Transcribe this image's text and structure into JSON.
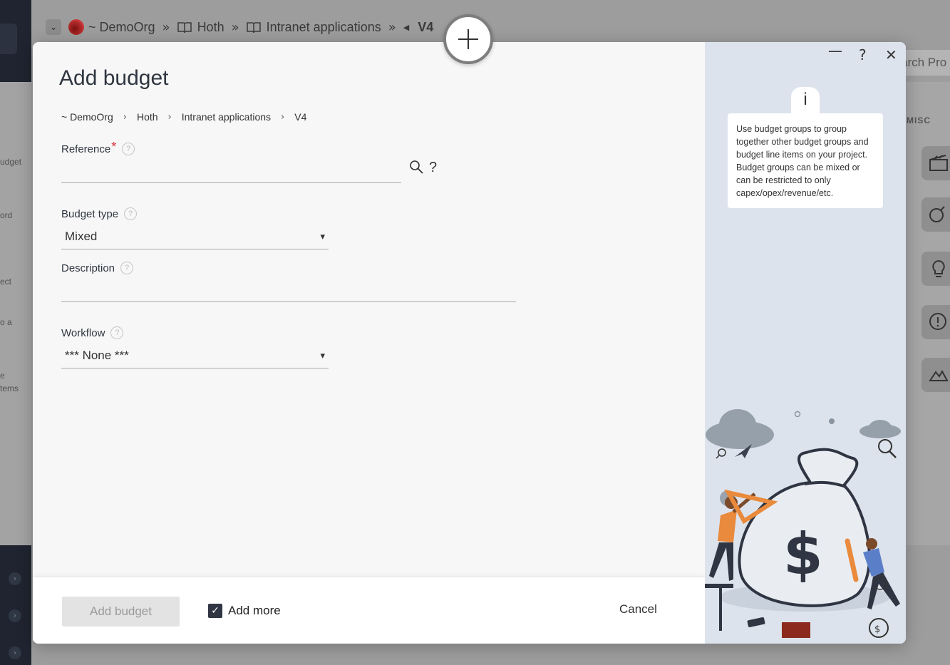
{
  "background": {
    "breadcrumb": {
      "org": "~ DemoOrg",
      "items": [
        "Hoth",
        "Intranet applications"
      ],
      "current": "V4",
      "separator": "»"
    },
    "search_placeholder": "arch Pro",
    "left_panel_fragments": [
      "udget",
      "ord",
      "ect",
      "o a",
      "e",
      "tems"
    ],
    "misc_heading": "MISC"
  },
  "modal": {
    "title": "Add budget",
    "breadcrumb": [
      "~ DemoOrg",
      "Hoth",
      "Intranet applications",
      "V4"
    ],
    "breadcrumb_separator": "›",
    "help_glyph": "?",
    "fields": {
      "reference": {
        "label": "Reference",
        "required_mark": "*",
        "value": "",
        "help_glyph": "?"
      },
      "budget_type": {
        "label": "Budget type",
        "selected": "Mixed"
      },
      "description": {
        "label": "Description",
        "value": ""
      },
      "workflow": {
        "label": "Workflow",
        "selected": "*** None ***"
      }
    },
    "footer": {
      "add_button": "Add budget",
      "add_more_label": "Add more",
      "add_more_checked": true,
      "cancel_label": "Cancel"
    },
    "window_controls": {
      "minimize": "—",
      "help": "?",
      "close": "✕"
    },
    "info": {
      "glyph": "i",
      "text": "Use budget groups to group together other budget groups and budget line items on your project. Budget groups can be mixed or can be restricted to only capex/opex/revenue/etc."
    },
    "illustration": {
      "dollar_glyph": "$",
      "small_bag_glyph": "$"
    }
  },
  "colors": {
    "modal_bg": "#f7f7f7",
    "side_panel_bg": "#dde3ec",
    "required": "#d9363e",
    "checkbox": "#2f3542",
    "dark_sidebar": "#1f2430"
  }
}
